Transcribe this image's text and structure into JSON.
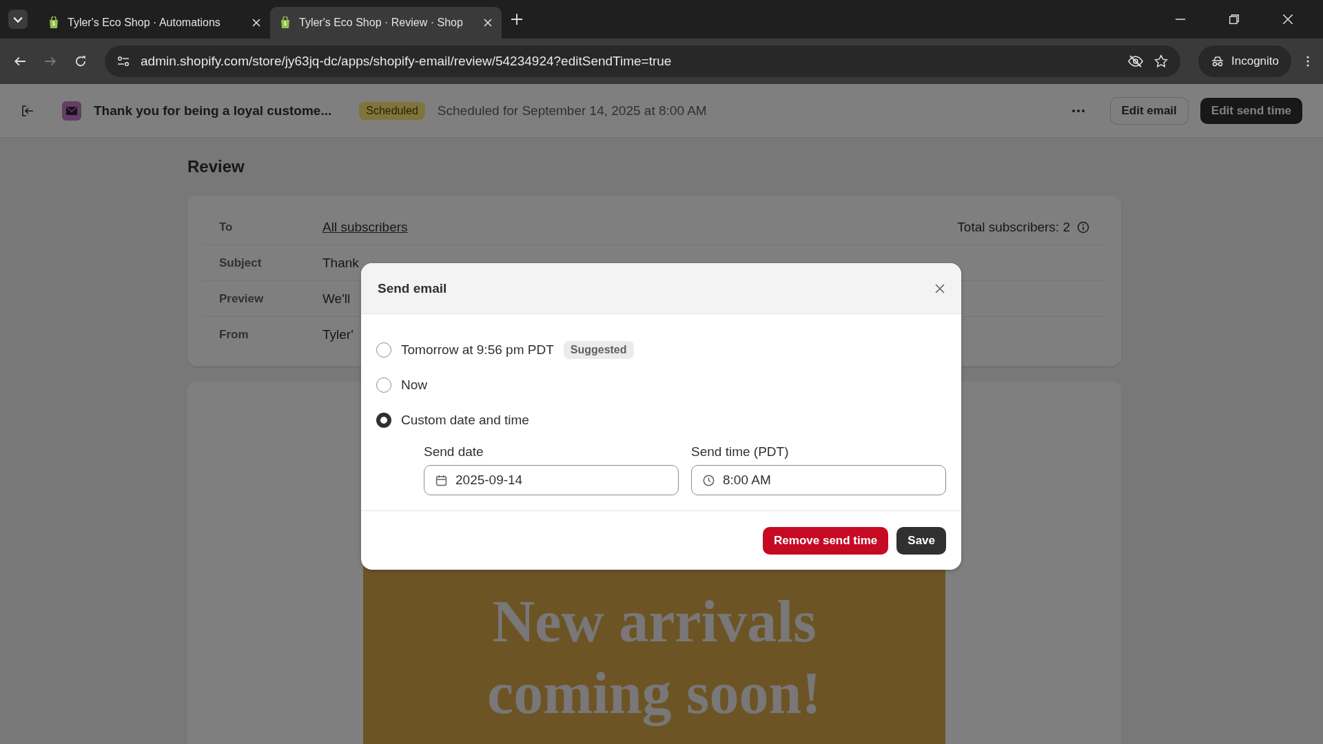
{
  "browser": {
    "tabs": [
      {
        "title": "Tyler's Eco Shop · Automations",
        "selected": false
      },
      {
        "title": "Tyler's Eco Shop · Review · Shop",
        "selected": true
      }
    ],
    "url": "admin.shopify.com/store/jy63jq-dc/apps/shopify-email/review/54234924?editSendTime=true",
    "profile": "Incognito"
  },
  "app_header": {
    "title": "Thank you for being a loyal custome...",
    "status": "Scheduled",
    "schedule": "Scheduled for September 14, 2025 at 8:00 AM",
    "buttons": [
      {
        "label": "Edit email",
        "kind": "secondary"
      },
      {
        "label": "Edit send time",
        "kind": "primary"
      }
    ]
  },
  "review": {
    "title": "Review",
    "total": "Total subscribers: 2",
    "rows": [
      {
        "label": "To",
        "value": "All subscribers",
        "kind": "link"
      },
      {
        "label": "Subject",
        "value": "Thank",
        "kind": "text"
      },
      {
        "label": "Preview",
        "value": "We'll",
        "kind": "text"
      },
      {
        "label": "From",
        "value": "Tyler'",
        "kind": "text"
      }
    ]
  },
  "banner": {
    "lines": [
      "New arrivals",
      "coming soon!"
    ]
  },
  "modal": {
    "title": "Send email",
    "options": [
      {
        "label": "Tomorrow at 9:56 pm PDT",
        "badge": "Suggested",
        "selected": false
      },
      {
        "label": "Now",
        "selected": false
      },
      {
        "label": "Custom date and time",
        "selected": true
      }
    ],
    "fields": [
      {
        "label": "Send date",
        "value": "2025-09-14",
        "kind": "date"
      },
      {
        "label": "Send time (PDT)",
        "value": "8:00 AM",
        "kind": "time"
      }
    ],
    "buttons": [
      {
        "label": "Remove send time",
        "kind": "critical"
      },
      {
        "label": "Save",
        "kind": "primary"
      }
    ]
  }
}
